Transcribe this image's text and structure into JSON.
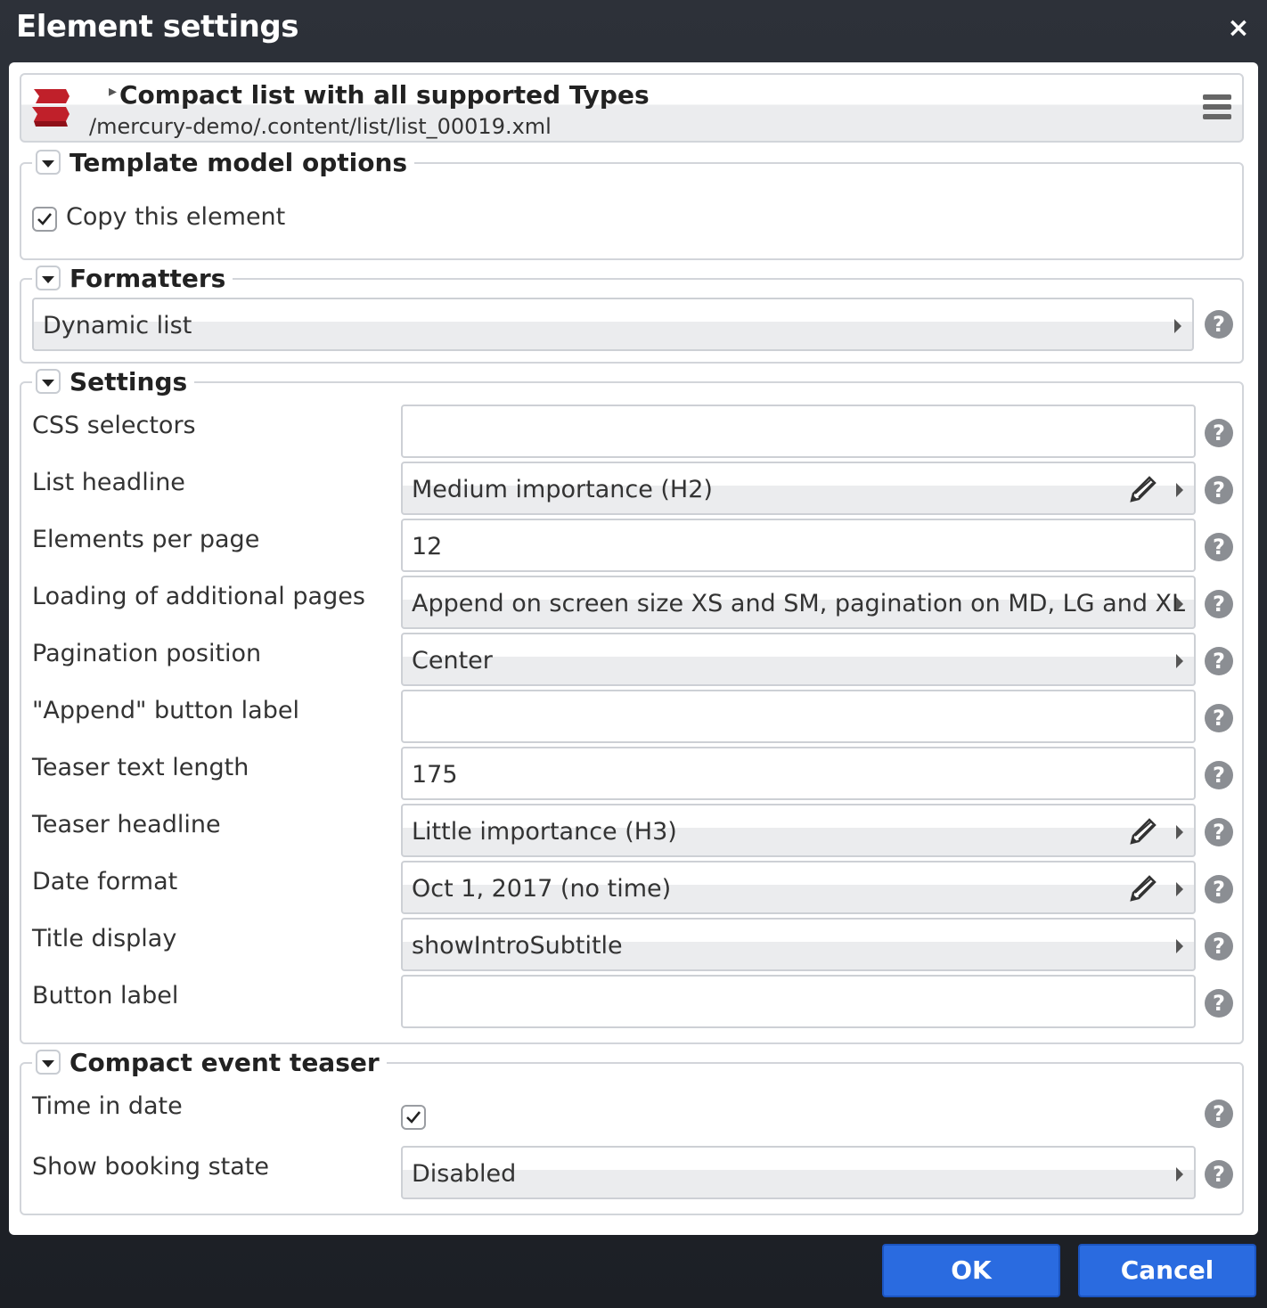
{
  "dialog": {
    "title": "Element settings",
    "close_icon": "×"
  },
  "resource": {
    "title": "Compact list with all supported Types",
    "path": "/mercury-demo/.content/list/list_00019.xml"
  },
  "template_model_options": {
    "legend": "Template model options",
    "copy_label": "Copy this element",
    "copy_checked": true
  },
  "formatters": {
    "legend": "Formatters",
    "value": "Dynamic list"
  },
  "settings": {
    "legend": "Settings",
    "rows": [
      {
        "label": "CSS selectors",
        "value": "",
        "kind": "text"
      },
      {
        "label": "List headline",
        "value": "Medium importance (H2)",
        "kind": "select-edit"
      },
      {
        "label": "Elements per page",
        "value": "12",
        "kind": "text"
      },
      {
        "label": "Loading of additional pages",
        "value": "Append on screen size XS and SM, pagination on MD, LG and XL",
        "kind": "select"
      },
      {
        "label": "Pagination position",
        "value": "Center",
        "kind": "select"
      },
      {
        "label": "\"Append\" button label",
        "value": "",
        "kind": "text"
      },
      {
        "label": "Teaser text length",
        "value": "175",
        "kind": "text"
      },
      {
        "label": "Teaser headline",
        "value": "Little importance (H3)",
        "kind": "select-edit"
      },
      {
        "label": "Date format",
        "value": "Oct 1, 2017 (no time)",
        "kind": "select-edit"
      },
      {
        "label": "Title display",
        "value": "showIntroSubtitle",
        "kind": "select"
      },
      {
        "label": "Button label",
        "value": "",
        "kind": "text"
      }
    ]
  },
  "compact_event_teaser": {
    "legend": "Compact event teaser",
    "time_in_date_label": "Time in date",
    "time_in_date_checked": true,
    "booking_label": "Show booking state",
    "booking_value": "Disabled"
  },
  "help_glyph": "?",
  "buttons": {
    "ok": "OK",
    "cancel": "Cancel"
  },
  "colors": {
    "primary": "#2a6be0",
    "brand_icon": "#c0202a"
  }
}
